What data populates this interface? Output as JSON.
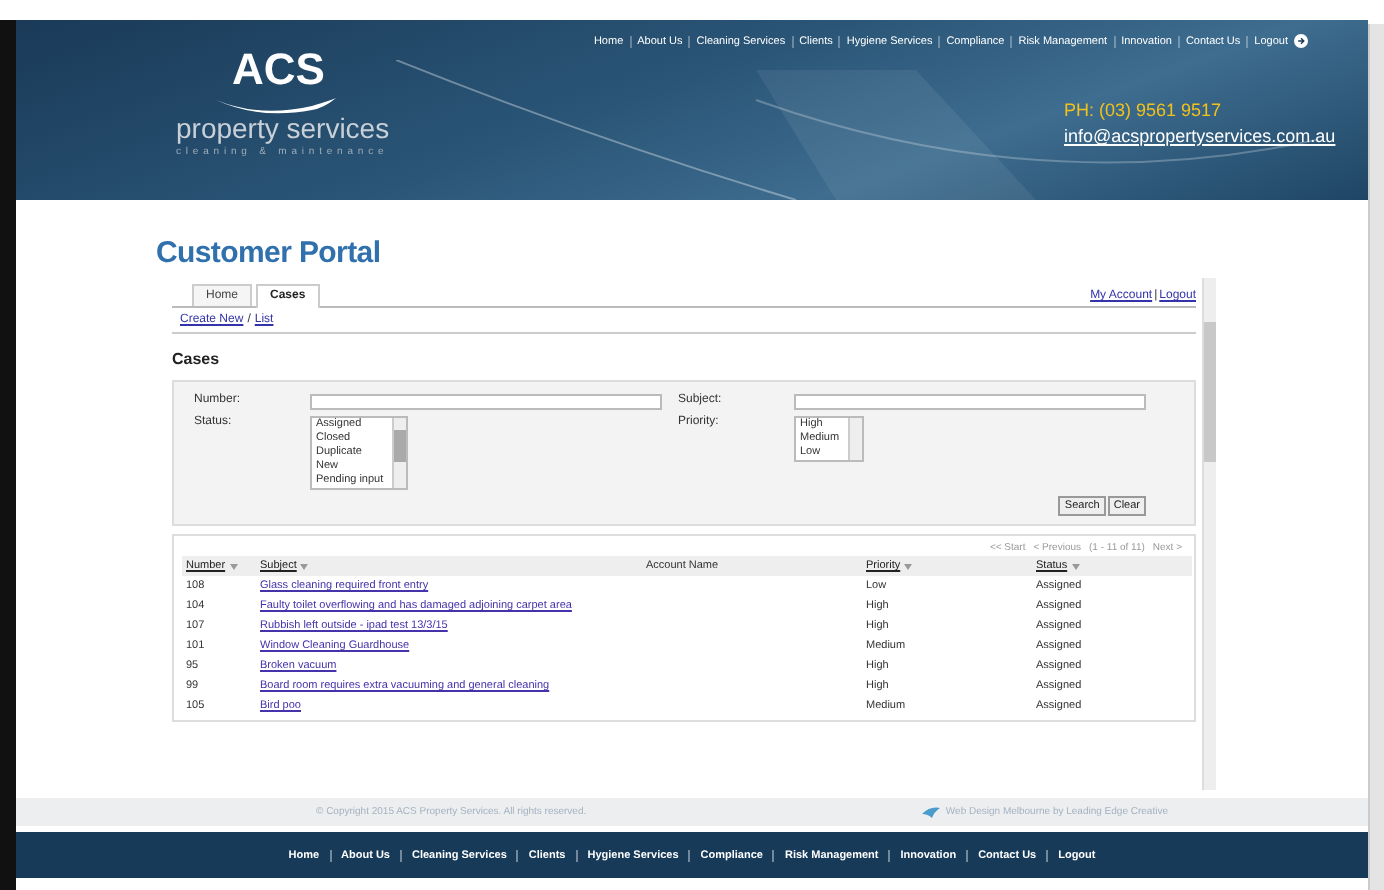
{
  "top_nav": {
    "items": [
      "Home",
      "About Us",
      "Cleaning Services",
      "Clients",
      "Hygiene Services",
      "Compliance",
      "Risk Management",
      "Innovation",
      "Contact Us",
      "Logout"
    ]
  },
  "logo": {
    "mark": "ACS",
    "name": "property services",
    "tagline": "cleaning & maintenance"
  },
  "contact": {
    "phone": "PH: (03) 9561 9517",
    "email": "info@acspropertyservices.com.au"
  },
  "page_title": "Customer Portal",
  "tabs": [
    {
      "label": "Home",
      "selected": false
    },
    {
      "label": "Cases",
      "selected": true
    }
  ],
  "account_links": {
    "items": [
      "My Account",
      "Logout"
    ],
    "separator": "|"
  },
  "sub_links": {
    "items": [
      "Create New",
      "List"
    ],
    "separator": "/"
  },
  "section_title": "Cases",
  "search": {
    "fields": [
      {
        "label": "Number:",
        "kind": "text"
      },
      {
        "label": "Subject:",
        "kind": "text"
      },
      {
        "label": "Status:",
        "kind": "list",
        "options": [
          "Assigned",
          "Closed",
          "Duplicate",
          "New",
          "Pending input"
        ]
      },
      {
        "label": "Priority:",
        "kind": "list",
        "options": [
          "High",
          "Medium",
          "Low"
        ]
      }
    ],
    "buttons": [
      "Search",
      "Clear"
    ]
  },
  "pager": [
    "<< Start",
    "< Previous",
    "(1 - 11 of 11)",
    "Next >"
  ],
  "table": {
    "columns": [
      {
        "label": "Number",
        "sortable": true
      },
      {
        "label": "Subject",
        "sortable": true
      },
      {
        "label": "Account Name",
        "sortable": false
      },
      {
        "label": "Priority",
        "sortable": true
      },
      {
        "label": "Status",
        "sortable": true
      }
    ],
    "rows": [
      {
        "number": "108",
        "subject": "Glass cleaning required front entry",
        "priority": "Low",
        "status": "Assigned"
      },
      {
        "number": "104",
        "subject": "Faulty toilet overflowing and has damaged adjoining carpet area",
        "priority": "High",
        "status": "Assigned"
      },
      {
        "number": "107",
        "subject": "Rubbish left outside - ipad test 13/3/15",
        "priority": "High",
        "status": "Assigned"
      },
      {
        "number": "101",
        "subject": "Window Cleaning Guardhouse",
        "priority": "Medium",
        "status": "Assigned"
      },
      {
        "number": "95",
        "subject": "Broken vacuum",
        "priority": "High",
        "status": "Assigned"
      },
      {
        "number": "99",
        "subject": "Board room requires extra vacuuming and general cleaning",
        "priority": "High",
        "status": "Assigned"
      },
      {
        "number": "105",
        "subject": "Bird poo",
        "priority": "Medium",
        "status": "Assigned"
      }
    ]
  },
  "footer": {
    "copyright": "© Copyright 2015 ACS Property Services. All rights reserved.",
    "credit": "Web Design Melbourne by Leading Edge Creative"
  },
  "bottom_nav": {
    "items": [
      "Home",
      "About Us",
      "Cleaning Services",
      "Clients",
      "Hygiene Services",
      "Compliance",
      "Risk Management",
      "Innovation",
      "Contact Us",
      "Logout"
    ]
  }
}
